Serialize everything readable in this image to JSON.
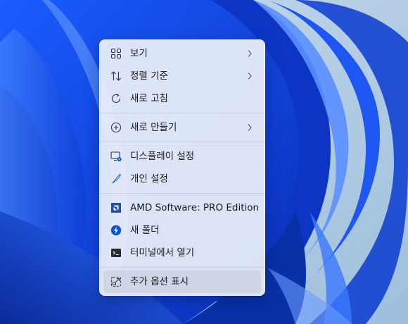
{
  "context_menu": {
    "groups": [
      [
        {
          "label": "보기",
          "icon": "view-grid-icon",
          "submenu": true
        },
        {
          "label": "정렬 기준",
          "icon": "sort-icon",
          "submenu": true
        },
        {
          "label": "새로 고침",
          "icon": "refresh-icon",
          "submenu": false
        }
      ],
      [
        {
          "label": "새로 만들기",
          "icon": "new-plus-icon",
          "submenu": true
        }
      ],
      [
        {
          "label": "디스플레이 설정",
          "icon": "display-settings-icon",
          "submenu": false
        },
        {
          "label": "개인 설정",
          "icon": "brush-icon",
          "submenu": false
        }
      ],
      [
        {
          "label": "AMD Software: PRO Edition",
          "icon": "amd-logo-icon",
          "submenu": false
        },
        {
          "label": "새 폴더",
          "icon": "lightning-icon",
          "submenu": false
        },
        {
          "label": "터미널에서 열기",
          "icon": "terminal-icon",
          "submenu": false
        }
      ],
      [
        {
          "label": "추가 옵션 표시",
          "icon": "more-options-icon",
          "submenu": false,
          "highlighted": true
        }
      ]
    ]
  },
  "colors": {
    "menu_background": "#ecf0fa",
    "text": "#1a1a1a",
    "accent_blue": "#0a55d6",
    "amd_blue": "#1f4fa6"
  }
}
